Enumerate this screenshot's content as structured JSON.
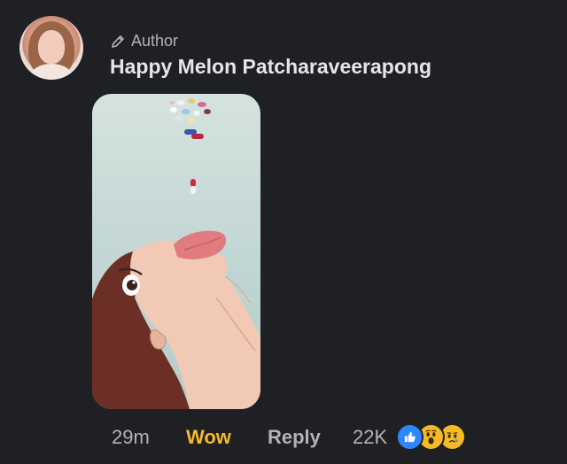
{
  "comment": {
    "author_badge": "Author",
    "author_name": "Happy Melon Patcharaveerapong",
    "timestamp": "29m",
    "selected_reaction": "Wow",
    "reply_label": "Reply",
    "reaction_count": "22K",
    "reaction_icons": [
      "like-icon",
      "wow-icon",
      "sad-icon"
    ]
  },
  "colors": {
    "background": "#1f2023",
    "primary_text": "#e4e6eb",
    "secondary_text": "#b0b3b8",
    "wow": "#f7b928",
    "like": "#2d88ff"
  }
}
